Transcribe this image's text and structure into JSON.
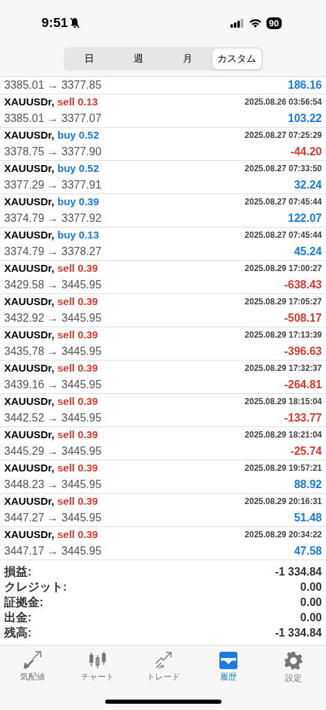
{
  "status_bar": {
    "time": "9:51",
    "battery": "90"
  },
  "segments": [
    {
      "label": "日",
      "selected": false
    },
    {
      "label": "週",
      "selected": false
    },
    {
      "label": "月",
      "selected": false
    },
    {
      "label": "カスタム",
      "selected": true
    }
  ],
  "partial_row": {
    "prices": "3385.01 → 3377.85",
    "profit": "186.16",
    "color": "#1a7be3"
  },
  "deals": [
    {
      "symbol": "XAUUSDr,",
      "order": "sell 0.13",
      "kind": "sell",
      "time": "2025.08.26 03:56:54",
      "prices": "3385.01 → 3377.07",
      "profit": "103.22",
      "color": "#1a7be3"
    },
    {
      "symbol": "XAUUSDr,",
      "order": "buy 0.52",
      "kind": "buy",
      "time": "2025.08.27 07:25:29",
      "prices": "3378.75 → 3377.90",
      "profit": "-44.20",
      "color": "#e0382c"
    },
    {
      "symbol": "XAUUSDr,",
      "order": "buy 0.52",
      "kind": "buy",
      "time": "2025.08.27 07:33:50",
      "prices": "3377.29 → 3377.91",
      "profit": "32.24",
      "color": "#1a7be3"
    },
    {
      "symbol": "XAUUSDr,",
      "order": "buy 0.39",
      "kind": "buy",
      "time": "2025.08.27 07:45:44",
      "prices": "3374.79 → 3377.92",
      "profit": "122.07",
      "color": "#1a7be3"
    },
    {
      "symbol": "XAUUSDr,",
      "order": "buy 0.13",
      "kind": "buy",
      "time": "2025.08.27 07:45:44",
      "prices": "3374.79 → 3378.27",
      "profit": "45.24",
      "color": "#1a7be3"
    },
    {
      "symbol": "XAUUSDr,",
      "order": "sell 0.39",
      "kind": "sell",
      "time": "2025.08.29 17:00:27",
      "prices": "3429.58 → 3445.95",
      "profit": "-638.43",
      "color": "#e0382c"
    },
    {
      "symbol": "XAUUSDr,",
      "order": "sell 0.39",
      "kind": "sell",
      "time": "2025.08.29 17:05:27",
      "prices": "3432.92 → 3445.95",
      "profit": "-508.17",
      "color": "#e0382c"
    },
    {
      "symbol": "XAUUSDr,",
      "order": "sell 0.39",
      "kind": "sell",
      "time": "2025.08.29 17:13:39",
      "prices": "3435.78 → 3445.95",
      "profit": "-396.63",
      "color": "#e0382c"
    },
    {
      "symbol": "XAUUSDr,",
      "order": "sell 0.39",
      "kind": "sell",
      "time": "2025.08.29 17:32:37",
      "prices": "3439.16 → 3445.95",
      "profit": "-264.81",
      "color": "#e0382c"
    },
    {
      "symbol": "XAUUSDr,",
      "order": "sell 0.39",
      "kind": "sell",
      "time": "2025.08.29 18:15:04",
      "prices": "3442.52 → 3445.95",
      "profit": "-133.77",
      "color": "#e0382c"
    },
    {
      "symbol": "XAUUSDr,",
      "order": "sell 0.39",
      "kind": "sell",
      "time": "2025.08.29 18:21:04",
      "prices": "3445.29 → 3445.95",
      "profit": "-25.74",
      "color": "#e0382c"
    },
    {
      "symbol": "XAUUSDr,",
      "order": "sell 0.39",
      "kind": "sell",
      "time": "2025.08.29 19:57:21",
      "prices": "3448.23 → 3445.95",
      "profit": "88.92",
      "color": "#1a7be3"
    },
    {
      "symbol": "XAUUSDr,",
      "order": "sell 0.39",
      "kind": "sell",
      "time": "2025.08.29 20:16:31",
      "prices": "3447.27 → 3445.95",
      "profit": "51.48",
      "color": "#1a7be3"
    },
    {
      "symbol": "XAUUSDr,",
      "order": "sell 0.39",
      "kind": "sell",
      "time": "2025.08.29 20:34:22",
      "prices": "3447.17 → 3445.95",
      "profit": "47.58",
      "color": "#1a7be3"
    }
  ],
  "summary": [
    {
      "label": "損益:",
      "value": "-1 334.84"
    },
    {
      "label": "クレジット:",
      "value": "0.00"
    },
    {
      "label": "証拠金:",
      "value": "0.00"
    },
    {
      "label": "出金:",
      "value": "0.00"
    },
    {
      "label": "残高:",
      "value": "-1 334.84"
    }
  ],
  "tab_bar": [
    {
      "label": "気配値",
      "selected": false
    },
    {
      "label": "チャート",
      "selected": false
    },
    {
      "label": "トレード",
      "selected": false
    },
    {
      "label": "履歴",
      "selected": true
    },
    {
      "label": "設定",
      "selected": false
    }
  ]
}
